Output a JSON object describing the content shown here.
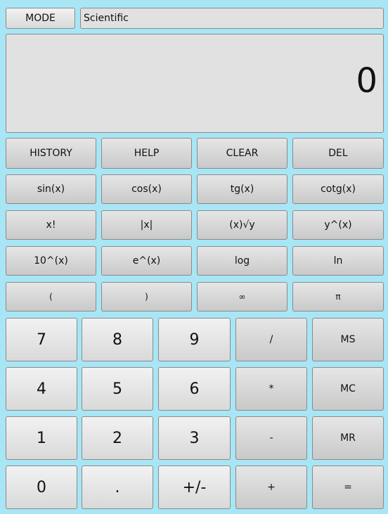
{
  "toolbar": {
    "mode_button": "MODE",
    "mode_value": "Scientific"
  },
  "display": {
    "value": "0"
  },
  "function_rows": [
    [
      "HISTORY",
      "HELP",
      "CLEAR",
      "DEL"
    ],
    [
      "sin(x)",
      "cos(x)",
      "tg(x)",
      "cotg(x)"
    ],
    [
      "x!",
      "|x|",
      "(x)√y",
      "y^(x)"
    ],
    [
      "10^(x)",
      "e^(x)",
      "log",
      "ln"
    ],
    [
      "(",
      ")",
      "∞",
      "π"
    ]
  ],
  "keypad_rows": [
    [
      "7",
      "8",
      "9",
      "/",
      "MS"
    ],
    [
      "4",
      "5",
      "6",
      "*",
      "MC"
    ],
    [
      "1",
      "2",
      "3",
      "-",
      "MR"
    ],
    [
      "0",
      ".",
      "+/-",
      "+",
      "="
    ]
  ],
  "colors": {
    "background": "#a8e6f6",
    "button_light": "#f2f2f2",
    "button_dark": "#d9d9d9",
    "display_bg": "#e1e1e1"
  }
}
